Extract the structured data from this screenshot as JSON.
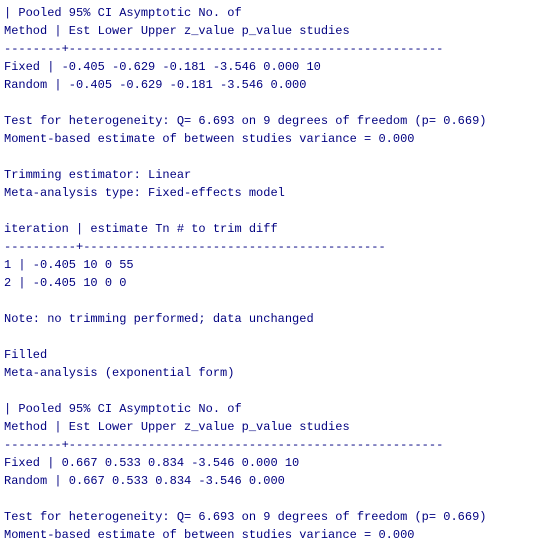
{
  "section1": {
    "header": {
      "l1": "        | Pooled      95% CI         Asymptotic      No. of",
      "l2": "Method  |    Est   Lower   Upper  z_value  p_value   studies"
    },
    "divider1": "--------+----------------------------------------------------",
    "rows": {
      "fixed": "Fixed   |  -0.405  -0.629  -0.181   -3.546    0.000     10",
      "random": "Random  |  -0.405  -0.629  -0.181   -3.546    0.000"
    },
    "het1": "Test for heterogeneity: Q=  6.693 on 9 degrees of freedom (p= 0.669)",
    "het2": "Moment-based estimate of between studies variance =  0.000"
  },
  "trim": {
    "l1": "Trimming estimator: Linear",
    "l2": "Meta-analysis type: Fixed-effects model",
    "header": "iteration |  estimate    Tn    # to trim    diff",
    "divider": "----------+------------------------------------------",
    "row1": "    1     |    -0.405    10        0          55",
    "row2": "    2     |    -0.405    10        0           0",
    "note": "Note: no trimming performed; data unchanged"
  },
  "filled": {
    "l1": "Filled",
    "l2": "Meta-analysis (exponential form)"
  },
  "section2": {
    "header": {
      "l1": "        | Pooled      95% CI         Asymptotic      No. of",
      "l2": "Method  |    Est   Lower   Upper  z_value  p_value   studies"
    },
    "divider1": "--------+----------------------------------------------------",
    "rows": {
      "fixed": "Fixed   |   0.667   0.533   0.834   -3.546    0.000     10",
      "random": "Random  |   0.667   0.533   0.834   -3.546    0.000"
    },
    "het1": "Test for heterogeneity: Q=  6.693 on 9 degrees of freedom (p= 0.669)",
    "het2": "Moment-based estimate of between studies variance =  0.000"
  }
}
